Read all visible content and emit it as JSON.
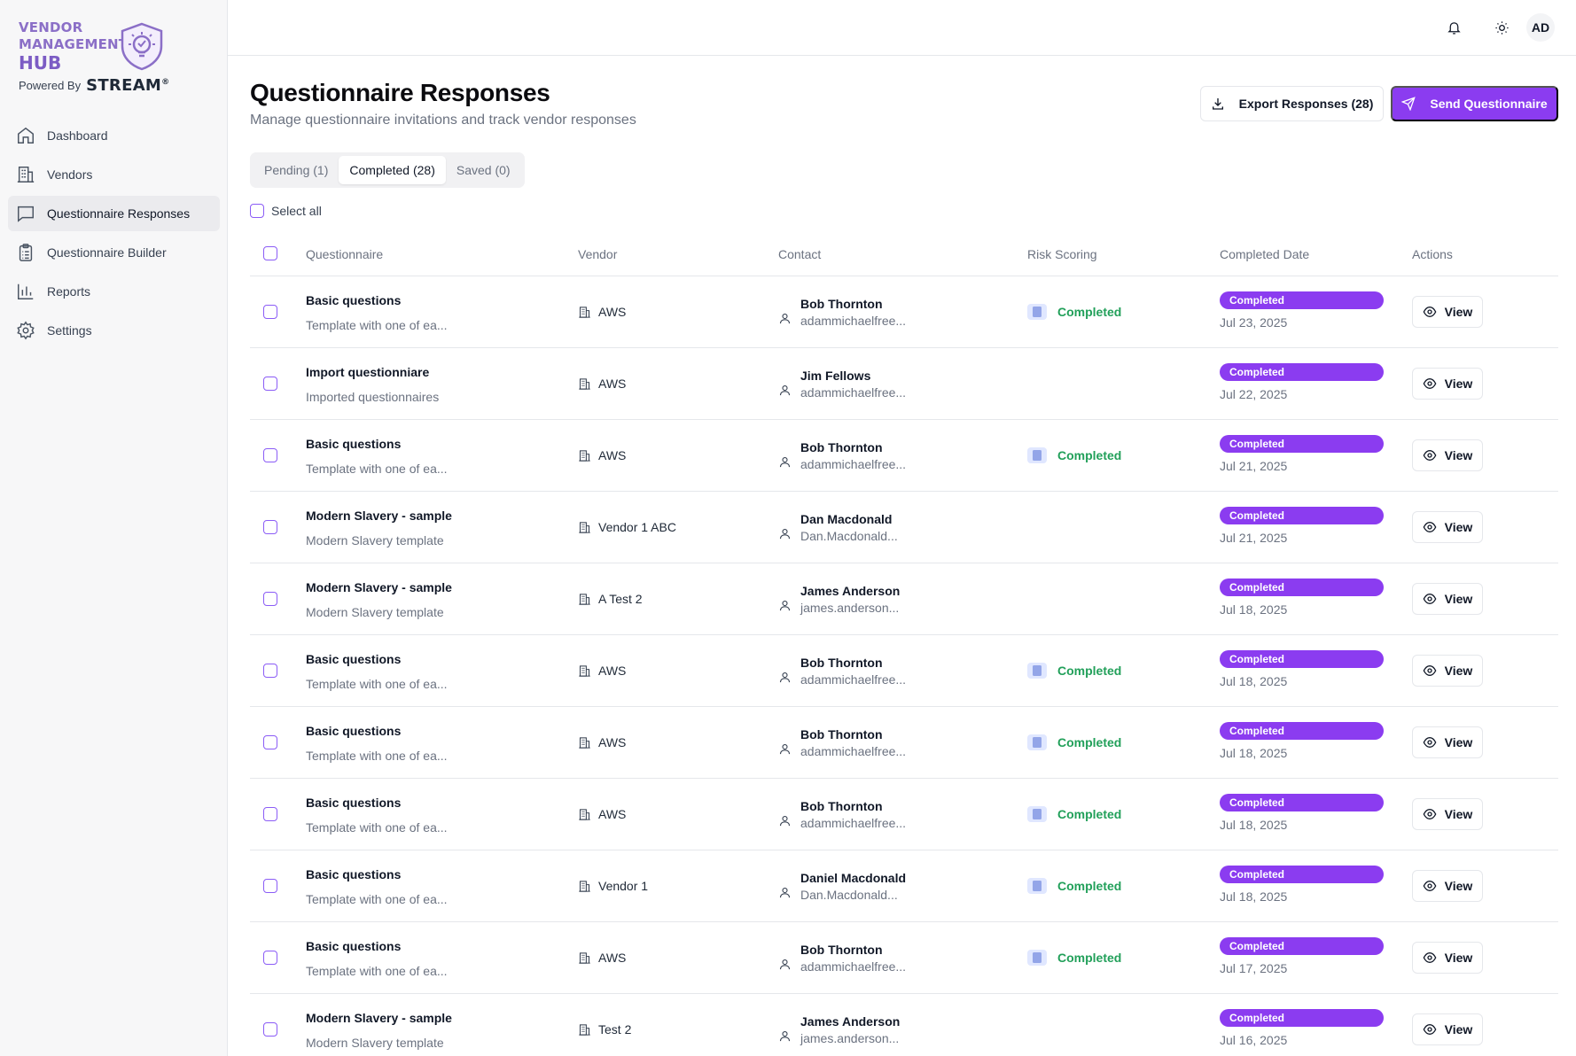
{
  "brand": {
    "line1": "VENDOR",
    "line2": "MANAGEMENT",
    "line3": "HUB",
    "powered_by": "Powered By",
    "stream": "STREAM",
    "reg": "®",
    "color": "#8b6fc7"
  },
  "sidebar": {
    "items": [
      {
        "label": "Dashboard",
        "icon": "home-icon",
        "active": false
      },
      {
        "label": "Vendors",
        "icon": "building-icon",
        "active": false
      },
      {
        "label": "Questionnaire Responses",
        "icon": "message-square-icon",
        "active": true
      },
      {
        "label": "Questionnaire Builder",
        "icon": "clipboard-list-icon",
        "active": false
      },
      {
        "label": "Reports",
        "icon": "bar-chart-icon",
        "active": false
      },
      {
        "label": "Settings",
        "icon": "gear-icon",
        "active": false
      }
    ]
  },
  "topbar": {
    "notification_icon": "bell-icon",
    "theme_icon": "sun-icon",
    "avatar_initials": "AD"
  },
  "page": {
    "title": "Questionnaire Responses",
    "subtitle": "Manage questionnaire invitations and track vendor responses",
    "export_label": "Export Responses (28)",
    "send_label": "Send Questionnaire",
    "accent": "#8b3cf0"
  },
  "tabs": [
    {
      "label": "Pending (1)",
      "active": false
    },
    {
      "label": "Completed (28)",
      "active": true
    },
    {
      "label": "Saved (0)",
      "active": false
    }
  ],
  "select_all_label": "Select all",
  "table": {
    "headers": {
      "questionnaire": "Questionnaire",
      "vendor": "Vendor",
      "contact": "Contact",
      "risk": "Risk Scoring",
      "date": "Completed Date",
      "actions": "Actions"
    },
    "view_label": "View",
    "rows": [
      {
        "title": "Basic questions",
        "desc": "Template with one of ea...",
        "vendor": "AWS",
        "contact_name": "Bob Thornton",
        "contact_email": "adammichaelfree...",
        "risk": "Completed",
        "status": "Completed",
        "date": "Jul 23, 2025"
      },
      {
        "title": "Import questionniare",
        "desc": "Imported questionnaires",
        "vendor": "AWS",
        "contact_name": "Jim Fellows",
        "contact_email": "adammichaelfree...",
        "risk": "",
        "status": "Completed",
        "date": "Jul 22, 2025"
      },
      {
        "title": "Basic questions",
        "desc": "Template with one of ea...",
        "vendor": "AWS",
        "contact_name": "Bob Thornton",
        "contact_email": "adammichaelfree...",
        "risk": "Completed",
        "status": "Completed",
        "date": "Jul 21, 2025"
      },
      {
        "title": "Modern Slavery - sample",
        "desc": "Modern Slavery template",
        "vendor": "Vendor 1 ABC",
        "contact_name": "Dan Macdonald",
        "contact_email": "Dan.Macdonald...",
        "risk": "",
        "status": "Completed",
        "date": "Jul 21, 2025"
      },
      {
        "title": "Modern Slavery - sample",
        "desc": "Modern Slavery template",
        "vendor": "A Test 2",
        "contact_name": "James Anderson",
        "contact_email": "james.anderson...",
        "risk": "",
        "status": "Completed",
        "date": "Jul 18, 2025"
      },
      {
        "title": "Basic questions",
        "desc": "Template with one of ea...",
        "vendor": "AWS",
        "contact_name": "Bob Thornton",
        "contact_email": "adammichaelfree...",
        "risk": "Completed",
        "status": "Completed",
        "date": "Jul 18, 2025"
      },
      {
        "title": "Basic questions",
        "desc": "Template with one of ea...",
        "vendor": "AWS",
        "contact_name": "Bob Thornton",
        "contact_email": "adammichaelfree...",
        "risk": "Completed",
        "status": "Completed",
        "date": "Jul 18, 2025"
      },
      {
        "title": "Basic questions",
        "desc": "Template with one of ea...",
        "vendor": "AWS",
        "contact_name": "Bob Thornton",
        "contact_email": "adammichaelfree...",
        "risk": "Completed",
        "status": "Completed",
        "date": "Jul 18, 2025"
      },
      {
        "title": "Basic questions",
        "desc": "Template with one of ea...",
        "vendor": "Vendor 1",
        "contact_name": "Daniel Macdonald",
        "contact_email": "Dan.Macdonald...",
        "risk": "Completed",
        "status": "Completed",
        "date": "Jul 18, 2025"
      },
      {
        "title": "Basic questions",
        "desc": "Template with one of ea...",
        "vendor": "AWS",
        "contact_name": "Bob Thornton",
        "contact_email": "adammichaelfree...",
        "risk": "Completed",
        "status": "Completed",
        "date": "Jul 17, 2025"
      },
      {
        "title": "Modern Slavery - sample",
        "desc": "Modern Slavery template",
        "vendor": "Test 2",
        "contact_name": "James Anderson",
        "contact_email": "james.anderson...",
        "risk": "",
        "status": "Completed",
        "date": "Jul 16, 2025"
      }
    ]
  }
}
